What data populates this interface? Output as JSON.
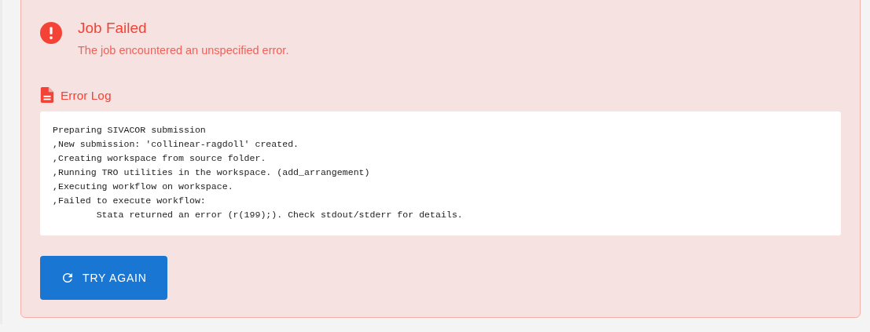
{
  "alert": {
    "title": "Job Failed",
    "message": "The job encountered an unspecified error."
  },
  "error_log": {
    "heading": "Error Log",
    "lines": [
      "Preparing SIVACOR submission",
      ",New submission: 'collinear-ragdoll' created.",
      ",Creating workspace from source folder.",
      ",Running TRO utilities in the workspace. (add_arrangement)",
      ",Executing workflow on workspace.",
      ",Failed to execute workflow:",
      "        Stata returned an error (r(199);). Check stdout/stderr for details."
    ]
  },
  "buttons": [
    {
      "label": "TRY AGAIN"
    }
  ]
}
